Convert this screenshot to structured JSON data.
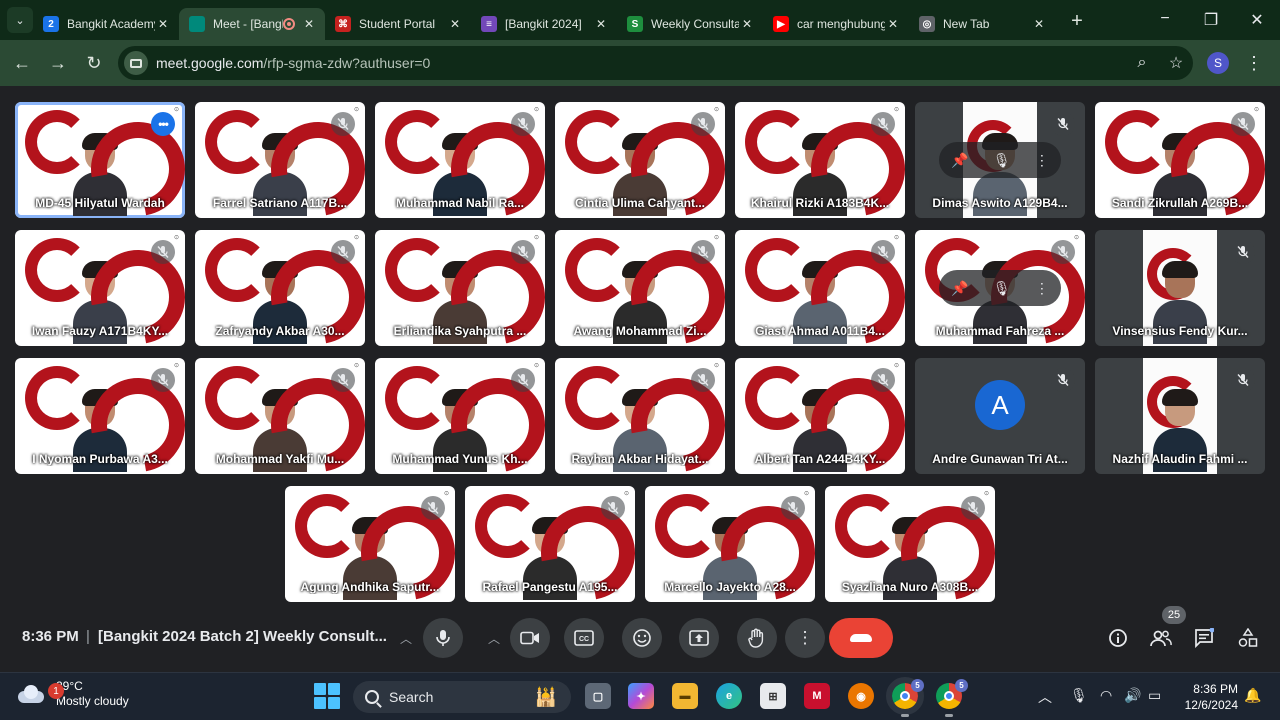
{
  "browser": {
    "tabs": [
      {
        "title": "Bangkit Academy",
        "icon": "bangkit-icon",
        "color": "#1a73e8",
        "glyph": "2"
      },
      {
        "title": "Meet - [Bangkit]",
        "icon": "meet-icon",
        "color": "#00897b",
        "glyph": "",
        "active": true,
        "recording": true
      },
      {
        "title": "Student Portal",
        "icon": "dicoding-icon",
        "color": "#c5221f",
        "glyph": "⌘"
      },
      {
        "title": "[Bangkit 2024]",
        "icon": "forms-icon",
        "color": "#7248b9",
        "glyph": "≡"
      },
      {
        "title": "Weekly Consultation",
        "icon": "sheets-icon",
        "color": "#1e8e3e",
        "glyph": "S"
      },
      {
        "title": "car menghubungkan",
        "icon": "youtube-icon",
        "color": "#ff0000",
        "glyph": "▶"
      },
      {
        "title": "New Tab",
        "icon": "chrome-icon",
        "color": "#5f6368",
        "glyph": "◎"
      }
    ],
    "url_host": "meet.google.com",
    "url_path": "/rfp-sgma-zdw?authuser=0",
    "profile_initial": "S"
  },
  "participants": [
    {
      "name": "MD-45 Hilyatul Wardah",
      "speaking": true,
      "style": "bangkit"
    },
    {
      "name": "Farrel Satriano A117B...",
      "style": "bangkit"
    },
    {
      "name": "Muhammad Nabil Ra...",
      "style": "bangkit"
    },
    {
      "name": "Cintia Ulima Cahyant...",
      "style": "bangkit"
    },
    {
      "name": "Khairul Rizki A183B4K...",
      "style": "bangkit"
    },
    {
      "name": "Dimas Aswito A129B4...",
      "style": "split",
      "hover": true
    },
    {
      "name": "Sandi Zikrullah A269B...",
      "style": "bangkit"
    },
    {
      "name": "Iwan Fauzy A171B4KY...",
      "style": "bangkit"
    },
    {
      "name": "Zafryandy Akbar A30...",
      "style": "bangkit"
    },
    {
      "name": "Erliandika Syahputra ...",
      "style": "bangkit"
    },
    {
      "name": "Awang Mohammad Zi...",
      "style": "bangkit"
    },
    {
      "name": "Giast Ahmad A011B4...",
      "style": "bangkit"
    },
    {
      "name": "Muhammad Fahreza ...",
      "style": "bangkit",
      "hover": true
    },
    {
      "name": "Vinsensius Fendy Kur...",
      "style": "split"
    },
    {
      "name": "I Nyoman Purbawa A3...",
      "style": "bangkit"
    },
    {
      "name": "Mohammad Yakfi Mu...",
      "style": "bangkit"
    },
    {
      "name": "Muhammad Yunus Kh...",
      "style": "bangkit"
    },
    {
      "name": "Rayhan Akbar Hidayat...",
      "style": "bangkit"
    },
    {
      "name": "Albert Tan A244B4KY...",
      "style": "bangkit"
    },
    {
      "name": "Andre Gunawan Tri At...",
      "style": "avatar",
      "initial": "A"
    },
    {
      "name": "Nazhif Alaudin Fahmi ...",
      "style": "split"
    },
    {
      "name": "Agung Andhika Saputr...",
      "style": "bangkit"
    },
    {
      "name": "Rafael Pangestu A195...",
      "style": "bangkit"
    },
    {
      "name": "Marcello Jayekto A28...",
      "style": "bangkit"
    },
    {
      "name": "Syazliana Nuro A308B...",
      "style": "bangkit"
    }
  ],
  "meeting": {
    "time": "8:36 PM",
    "separator": "|",
    "title": "[Bangkit 2024 Batch 2] Weekly Consult...",
    "participant_count": "25"
  },
  "taskbar": {
    "weather_temp": "29°C",
    "weather_desc": "Mostly cloudy",
    "weather_badge": "1",
    "search_label": "Search",
    "clock_time": "8:36 PM",
    "clock_date": "12/6/2024",
    "chrome_badge_1": "5",
    "chrome_badge_2": "5"
  },
  "colors": {
    "leave_red": "#ea4335",
    "speaking_blue": "#8ab4f8",
    "bangkit_red": "#b3131c"
  }
}
